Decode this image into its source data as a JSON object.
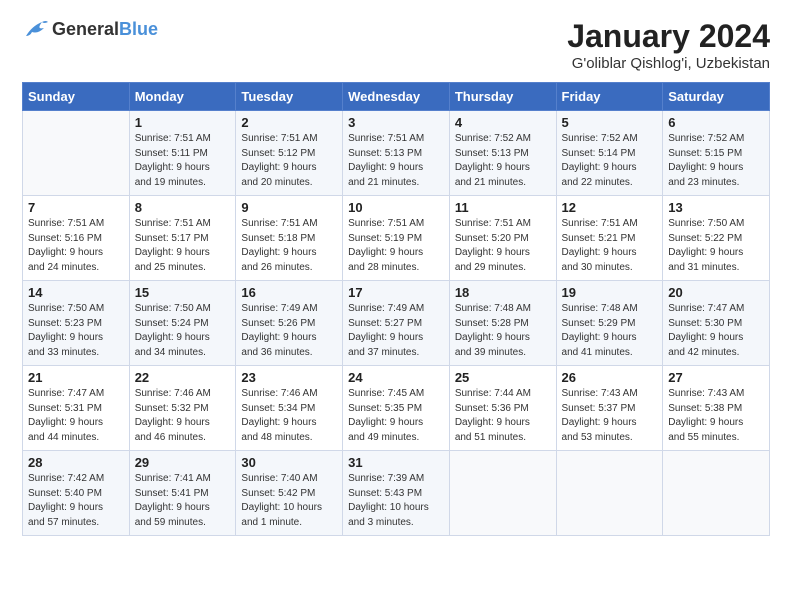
{
  "header": {
    "logo_general": "General",
    "logo_blue": "Blue",
    "title": "January 2024",
    "location": "G'oliblar Qishlog'i, Uzbekistan"
  },
  "weekdays": [
    "Sunday",
    "Monday",
    "Tuesday",
    "Wednesday",
    "Thursday",
    "Friday",
    "Saturday"
  ],
  "weeks": [
    [
      {
        "num": "",
        "info": ""
      },
      {
        "num": "1",
        "info": "Sunrise: 7:51 AM\nSunset: 5:11 PM\nDaylight: 9 hours\nand 19 minutes."
      },
      {
        "num": "2",
        "info": "Sunrise: 7:51 AM\nSunset: 5:12 PM\nDaylight: 9 hours\nand 20 minutes."
      },
      {
        "num": "3",
        "info": "Sunrise: 7:51 AM\nSunset: 5:13 PM\nDaylight: 9 hours\nand 21 minutes."
      },
      {
        "num": "4",
        "info": "Sunrise: 7:52 AM\nSunset: 5:13 PM\nDaylight: 9 hours\nand 21 minutes."
      },
      {
        "num": "5",
        "info": "Sunrise: 7:52 AM\nSunset: 5:14 PM\nDaylight: 9 hours\nand 22 minutes."
      },
      {
        "num": "6",
        "info": "Sunrise: 7:52 AM\nSunset: 5:15 PM\nDaylight: 9 hours\nand 23 minutes."
      }
    ],
    [
      {
        "num": "7",
        "info": "Sunrise: 7:51 AM\nSunset: 5:16 PM\nDaylight: 9 hours\nand 24 minutes."
      },
      {
        "num": "8",
        "info": "Sunrise: 7:51 AM\nSunset: 5:17 PM\nDaylight: 9 hours\nand 25 minutes."
      },
      {
        "num": "9",
        "info": "Sunrise: 7:51 AM\nSunset: 5:18 PM\nDaylight: 9 hours\nand 26 minutes."
      },
      {
        "num": "10",
        "info": "Sunrise: 7:51 AM\nSunset: 5:19 PM\nDaylight: 9 hours\nand 28 minutes."
      },
      {
        "num": "11",
        "info": "Sunrise: 7:51 AM\nSunset: 5:20 PM\nDaylight: 9 hours\nand 29 minutes."
      },
      {
        "num": "12",
        "info": "Sunrise: 7:51 AM\nSunset: 5:21 PM\nDaylight: 9 hours\nand 30 minutes."
      },
      {
        "num": "13",
        "info": "Sunrise: 7:50 AM\nSunset: 5:22 PM\nDaylight: 9 hours\nand 31 minutes."
      }
    ],
    [
      {
        "num": "14",
        "info": "Sunrise: 7:50 AM\nSunset: 5:23 PM\nDaylight: 9 hours\nand 33 minutes."
      },
      {
        "num": "15",
        "info": "Sunrise: 7:50 AM\nSunset: 5:24 PM\nDaylight: 9 hours\nand 34 minutes."
      },
      {
        "num": "16",
        "info": "Sunrise: 7:49 AM\nSunset: 5:26 PM\nDaylight: 9 hours\nand 36 minutes."
      },
      {
        "num": "17",
        "info": "Sunrise: 7:49 AM\nSunset: 5:27 PM\nDaylight: 9 hours\nand 37 minutes."
      },
      {
        "num": "18",
        "info": "Sunrise: 7:48 AM\nSunset: 5:28 PM\nDaylight: 9 hours\nand 39 minutes."
      },
      {
        "num": "19",
        "info": "Sunrise: 7:48 AM\nSunset: 5:29 PM\nDaylight: 9 hours\nand 41 minutes."
      },
      {
        "num": "20",
        "info": "Sunrise: 7:47 AM\nSunset: 5:30 PM\nDaylight: 9 hours\nand 42 minutes."
      }
    ],
    [
      {
        "num": "21",
        "info": "Sunrise: 7:47 AM\nSunset: 5:31 PM\nDaylight: 9 hours\nand 44 minutes."
      },
      {
        "num": "22",
        "info": "Sunrise: 7:46 AM\nSunset: 5:32 PM\nDaylight: 9 hours\nand 46 minutes."
      },
      {
        "num": "23",
        "info": "Sunrise: 7:46 AM\nSunset: 5:34 PM\nDaylight: 9 hours\nand 48 minutes."
      },
      {
        "num": "24",
        "info": "Sunrise: 7:45 AM\nSunset: 5:35 PM\nDaylight: 9 hours\nand 49 minutes."
      },
      {
        "num": "25",
        "info": "Sunrise: 7:44 AM\nSunset: 5:36 PM\nDaylight: 9 hours\nand 51 minutes."
      },
      {
        "num": "26",
        "info": "Sunrise: 7:43 AM\nSunset: 5:37 PM\nDaylight: 9 hours\nand 53 minutes."
      },
      {
        "num": "27",
        "info": "Sunrise: 7:43 AM\nSunset: 5:38 PM\nDaylight: 9 hours\nand 55 minutes."
      }
    ],
    [
      {
        "num": "28",
        "info": "Sunrise: 7:42 AM\nSunset: 5:40 PM\nDaylight: 9 hours\nand 57 minutes."
      },
      {
        "num": "29",
        "info": "Sunrise: 7:41 AM\nSunset: 5:41 PM\nDaylight: 9 hours\nand 59 minutes."
      },
      {
        "num": "30",
        "info": "Sunrise: 7:40 AM\nSunset: 5:42 PM\nDaylight: 10 hours\nand 1 minute."
      },
      {
        "num": "31",
        "info": "Sunrise: 7:39 AM\nSunset: 5:43 PM\nDaylight: 10 hours\nand 3 minutes."
      },
      {
        "num": "",
        "info": ""
      },
      {
        "num": "",
        "info": ""
      },
      {
        "num": "",
        "info": ""
      }
    ]
  ]
}
